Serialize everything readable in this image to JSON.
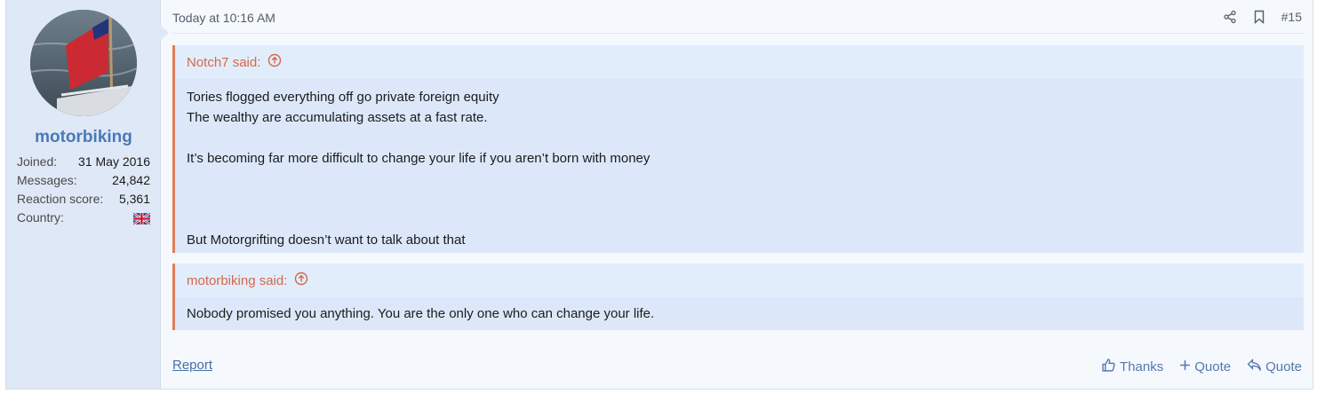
{
  "user": {
    "username": "motorbiking",
    "stats": [
      {
        "label": "Joined:",
        "value": "31 May 2016"
      },
      {
        "label": "Messages:",
        "value": "24,842"
      },
      {
        "label": "Reaction score:",
        "value": "5,361"
      },
      {
        "label": "Country:",
        "value": ""
      }
    ]
  },
  "post": {
    "date": "Today at 10:16 AM",
    "number": "#15"
  },
  "quotes": [
    {
      "author": "Notch7 said:",
      "lines": [
        "Tories flogged everything off go private foreign equity",
        "The wealthy are accumulating assets at a fast rate.",
        "",
        "It’s becoming far more difficult to change your life if you aren’t born with money",
        "",
        "",
        "",
        "But Motorgrifting doesn’t want to talk about that"
      ]
    },
    {
      "author": "motorbiking said:",
      "lines": [
        "Nobody promised you anything. You are the only one who can change your life."
      ]
    }
  ],
  "footer": {
    "report": "Report",
    "thanks": "Thanks",
    "multi_quote": "Quote",
    "quote": "Quote"
  },
  "colors": {
    "accent": "#4a78b8",
    "quote_border": "#e07d58",
    "quote_author": "#d3694a",
    "quote_bg": "#dce8fa"
  }
}
